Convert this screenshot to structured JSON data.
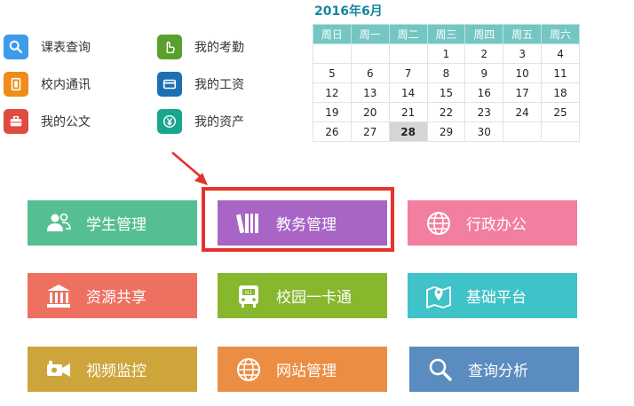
{
  "quick_links": [
    {
      "label": "课表查询",
      "icon": "search-icon",
      "color": "#3d9be9"
    },
    {
      "label": "我的考勤",
      "icon": "hand-icon",
      "color": "#5aa02c"
    },
    {
      "label": "校内通讯",
      "icon": "phone-book-icon",
      "color": "#f08c17"
    },
    {
      "label": "我的工资",
      "icon": "card-icon",
      "color": "#1b6fb3"
    },
    {
      "label": "我的公文",
      "icon": "briefcase-icon",
      "color": "#e04b3f"
    },
    {
      "label": "我的资产",
      "icon": "yen-icon",
      "color": "#1aa68d"
    }
  ],
  "calendar": {
    "title": "2016年6月",
    "weekdays": [
      "周日",
      "周一",
      "周二",
      "周三",
      "周四",
      "周五",
      "周六"
    ],
    "weeks": [
      [
        "",
        "",
        "",
        "1",
        "2",
        "3",
        "4"
      ],
      [
        "5",
        "6",
        "7",
        "8",
        "9",
        "10",
        "11"
      ],
      [
        "12",
        "13",
        "14",
        "15",
        "16",
        "17",
        "18"
      ],
      [
        "19",
        "20",
        "21",
        "22",
        "23",
        "24",
        "25"
      ],
      [
        "26",
        "27",
        "28",
        "29",
        "30",
        "",
        ""
      ]
    ],
    "today": "28",
    "header_color": "#74c6c2",
    "title_color": "#17869c"
  },
  "tiles": [
    {
      "label": "学生管理",
      "icon": "users-icon",
      "color": "#56bf92"
    },
    {
      "label": "教务管理",
      "icon": "books-icon",
      "color": "#a865c6"
    },
    {
      "label": "行政办公",
      "icon": "globe-icon",
      "color": "#f27f9f"
    },
    {
      "label": "资源共享",
      "icon": "building-icon",
      "color": "#ee7060"
    },
    {
      "label": "校园一卡通",
      "icon": "bus-card-icon",
      "color": "#86b72d"
    },
    {
      "label": "基础平台",
      "icon": "map-pin-icon",
      "color": "#3fc2c8"
    },
    {
      "label": "视频监控",
      "icon": "camera-icon",
      "color": "#cda53a"
    },
    {
      "label": "网站管理",
      "icon": "globe-icon",
      "color": "#eb8e44"
    },
    {
      "label": "查询分析",
      "icon": "search-icon",
      "color": "#5b8cbf"
    }
  ],
  "highlight_color": "#e5322d"
}
